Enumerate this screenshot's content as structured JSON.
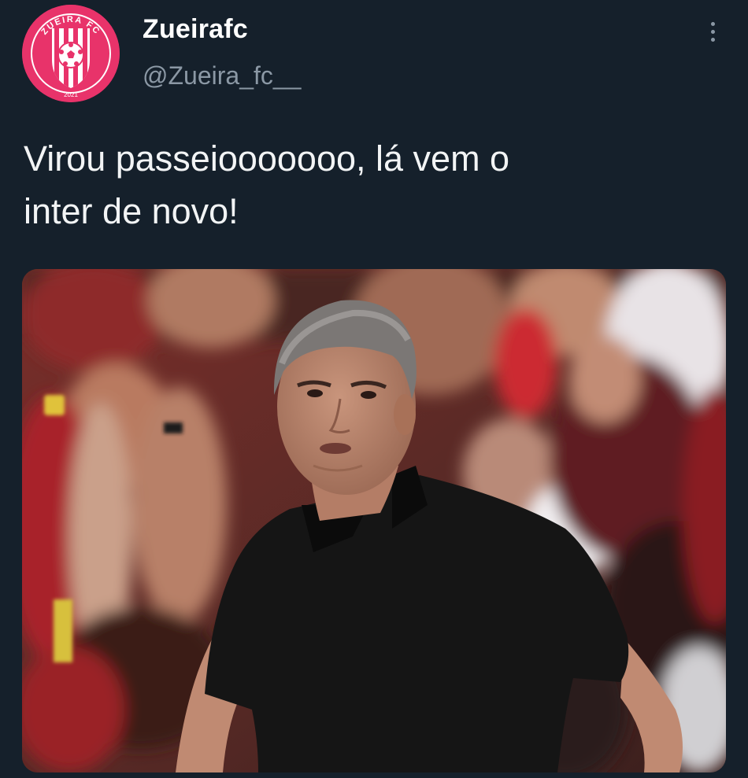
{
  "tweet": {
    "author": {
      "display_name": "Zueirafc",
      "handle": "@Zueira_fc__",
      "avatar": {
        "icon": "club-crest-icon",
        "crest_ring_text": "ZUEIRA FC",
        "crest_year": "2021"
      }
    },
    "more_icon": "more-vertical-icon",
    "text": "Virou passeiooooooo, lá vem o\ninter de novo!",
    "media": {
      "type": "photo"
    }
  },
  "colors": {
    "background": "#15202b",
    "text": "#ffffff",
    "secondary_text": "#8b98a5",
    "avatar_pink": "#e8336a"
  }
}
